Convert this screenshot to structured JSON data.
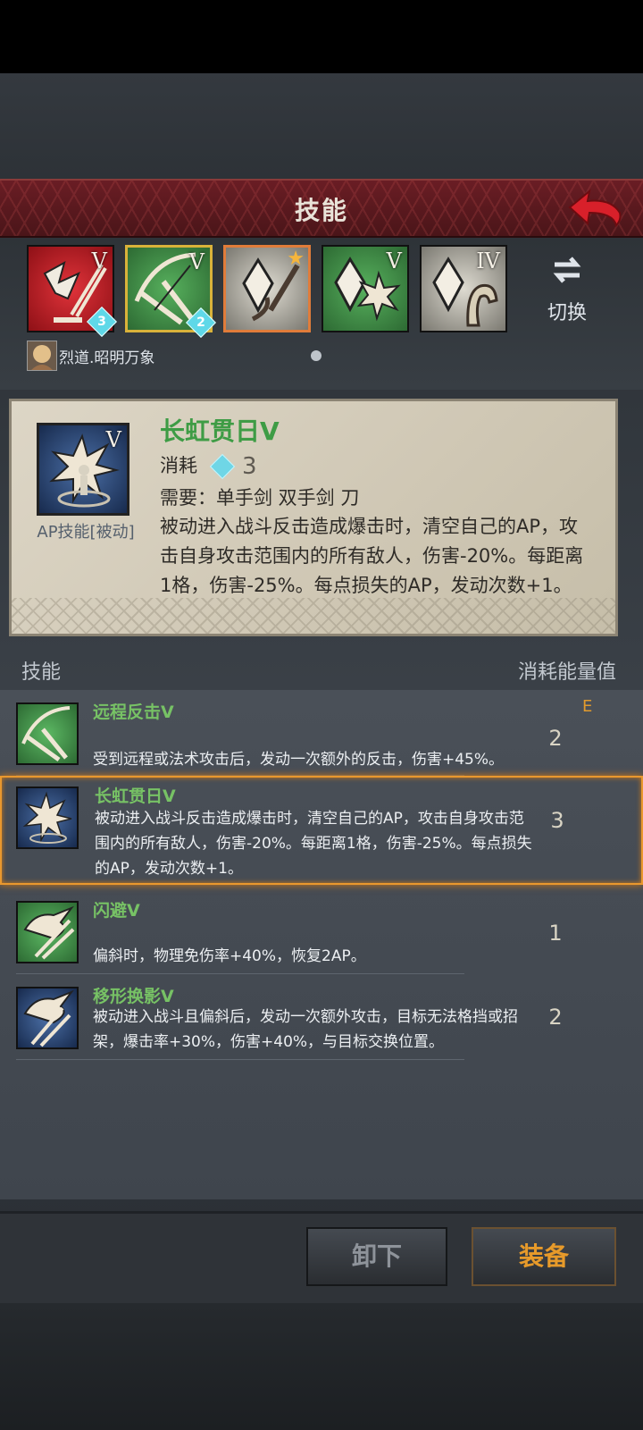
{
  "header": {
    "title": "技能"
  },
  "skill_slots": [
    {
      "rank": "V",
      "count": "3",
      "theme": "red",
      "icon": "broken-sword-icon"
    },
    {
      "rank": "V",
      "count": "2",
      "theme": "green",
      "icon": "sword-bow-icon"
    },
    {
      "rank": "",
      "count": "",
      "theme": "grey",
      "icon": "gem-sword-icon"
    },
    {
      "rank": "V",
      "count": "",
      "theme": "green",
      "icon": "gem-burst-icon"
    },
    {
      "rank": "IV",
      "count": "",
      "theme": "grey",
      "icon": "gem-figure-icon"
    }
  ],
  "switch_label": "切换",
  "character_name": "烈道.昭明万象",
  "detail": {
    "rank": "V",
    "type_label": "AP技能[被动]",
    "title": "长虹贯日V",
    "cost_label": "消耗",
    "cost_value": "3",
    "requirement": "需要：单手剑 双手剑 刀",
    "description": "被动进入战斗反击造成爆击时，清空自己的AP，攻击自身攻击范围内的所有敌人，伤害-20%。每距离1格，伤害-25%。每点损失的AP，发动次数+1。"
  },
  "list_header": {
    "skill": "技能",
    "cost": "消耗能量值"
  },
  "skills": [
    {
      "name": "远程反击V",
      "description": "受到远程或法术攻击后，发动一次额外的反击，伤害+45%。",
      "cost": "2",
      "badge": "E",
      "theme": "green"
    },
    {
      "name": "长虹贯日V",
      "description": "被动进入战斗反击造成爆击时，清空自己的AP，攻击自身攻击范围内的所有敌人，伤害-20%。每距离1格，伤害-25%。每点损失的AP，发动次数+1。",
      "cost": "3",
      "badge": "",
      "theme": "blue"
    },
    {
      "name": "闪避V",
      "description": "偏斜时，物理免伤率+40%，恢复2AP。",
      "cost": "1",
      "badge": "",
      "theme": "green"
    },
    {
      "name": "移形换影V",
      "description": "被动进入战斗且偏斜后，发动一次额外攻击，目标无法格挡或招架，爆击率+30%，伤害+40%，与目标交换位置。",
      "cost": "2",
      "badge": "",
      "theme": "blue"
    }
  ],
  "buttons": {
    "unequip": "卸下",
    "equip": "装备"
  },
  "colors": {
    "accent": "#e79a2a",
    "skill_name": "#77c265",
    "header": "#6a1d24"
  }
}
